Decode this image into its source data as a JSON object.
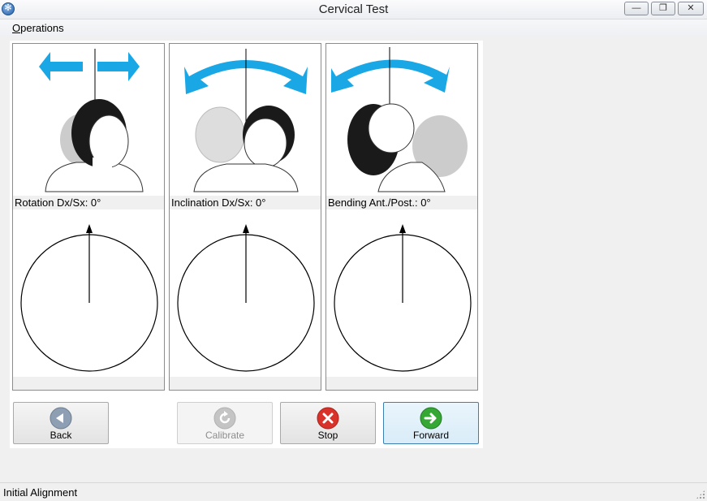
{
  "window": {
    "title": "Cervical Test",
    "minimize": "—",
    "restore": "❐",
    "close": "✕"
  },
  "menu": {
    "operations_first": "O",
    "operations_rest": "perations"
  },
  "panels": [
    {
      "label": "Rotation Dx/Sx: 0°",
      "angle_deg": 0
    },
    {
      "label": "Inclination Dx/Sx: 0°",
      "angle_deg": 0
    },
    {
      "label": "Bending Ant./Post.: 0°",
      "angle_deg": 0
    }
  ],
  "buttons": {
    "back": "Back",
    "calibrate": "Calibrate",
    "stop": "Stop",
    "forward": "Forward"
  },
  "status": {
    "text": "Initial Alignment"
  },
  "colors": {
    "arrow": "#1aa7e6",
    "stop": "#d9322a",
    "forward": "#2e9e2e",
    "back": "#7d8fa3"
  }
}
